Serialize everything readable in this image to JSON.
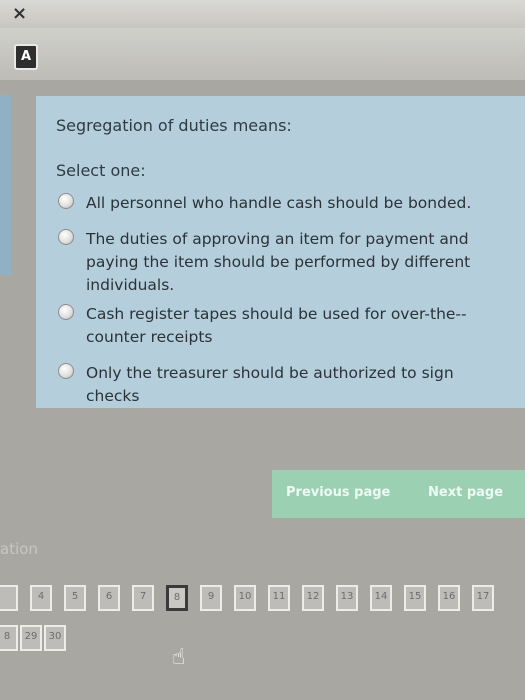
{
  "window": {
    "close_glyph": "×",
    "app_icon_letter": "A"
  },
  "question": {
    "title": "Segregation of duties means:",
    "select_label": "Select one:",
    "options": [
      {
        "line1": "All personnel who handle cash should be bonded."
      },
      {
        "line1": "The duties of approving an item for payment and",
        "line2": "paying the item should be performed by different",
        "line3": "individuals."
      },
      {
        "line1": "Cash register tapes should be used for over-the--",
        "line2": "counter receipts"
      },
      {
        "line1": "Only the treasurer should be authorized to sign checks"
      }
    ]
  },
  "navigation": {
    "previous_label": "Previous page",
    "next_label": "Next page"
  },
  "finish_label": "ation",
  "pager": {
    "row1": [
      "",
      "4",
      "5",
      "6",
      "7",
      "8",
      "9",
      "10",
      "11",
      "12",
      "13",
      "14",
      "15",
      "16",
      "17"
    ],
    "row2": [
      "8",
      "29",
      "30"
    ],
    "current": "8"
  },
  "colors": {
    "question_bg": "#b4cedb",
    "nav_bg": "#9bd0b3"
  },
  "icons": {
    "pointer": "hand-pointer-icon"
  }
}
